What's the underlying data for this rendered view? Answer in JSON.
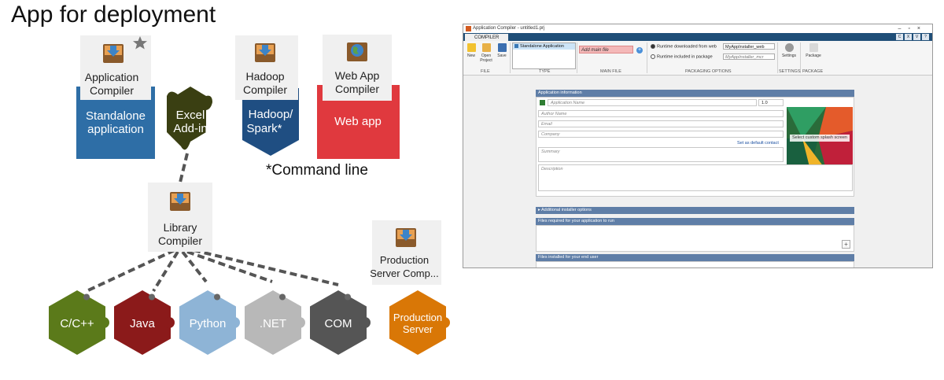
{
  "title": "App for deployment",
  "note": "*Command line",
  "diagram": {
    "compilers": {
      "application": {
        "line1": "Application",
        "line2": "Compiler"
      },
      "hadoop": {
        "line1": "Hadoop",
        "line2": "Compiler"
      },
      "webapp": {
        "line1": "Web App",
        "line2": "Compiler"
      },
      "library": {
        "line1": "Library",
        "line2": "Compiler"
      },
      "production": {
        "line1": "Production",
        "line2": "Server Comp..."
      }
    },
    "targets": {
      "standalone": {
        "line1": "Standalone",
        "line2": "application",
        "color": "#2e6ea6"
      },
      "excel": {
        "line1": "Excel",
        "line2": "Add-in",
        "color": "#3a3f12"
      },
      "hadoop": {
        "line1": "Hadoop/",
        "line2": "Spark*",
        "color": "#1f4e82"
      },
      "webapp": {
        "line1": "Web app",
        "color": "#e0393e"
      }
    },
    "languages": [
      {
        "label": "C/C++",
        "color": "#5b7a1a"
      },
      {
        "label": "Java",
        "color": "#8b1a1a"
      },
      {
        "label": "Python",
        "color": "#8eb4d6"
      },
      {
        "label": ".NET",
        "color": "#b8b8b8"
      },
      {
        "label": "COM",
        "color": "#555555"
      },
      {
        "line1": "Production",
        "line2": "Server",
        "color": "#d97706"
      }
    ]
  },
  "app_window": {
    "title": "Application Compiler - untitled1.prj",
    "tab": "COMPILER",
    "quick_access": [
      "C",
      "X",
      "V"
    ],
    "ribbon": {
      "new": "New",
      "open_line1": "Open",
      "open_line2": "Project",
      "save": "Save",
      "type_selected": "Standalone Application",
      "main_file_placeholder": "Add main file",
      "runtime_web": "Runtime downloaded from web",
      "runtime_web_value": "MyAppInstaller_web",
      "runtime_pkg": "Runtime included in package",
      "runtime_pkg_value": "MyAppInstaller_mcr",
      "settings": "Settings",
      "package": "Package",
      "sections": [
        "FILE",
        "TYPE",
        "MAIN FILE",
        "PACKAGING OPTIONS",
        "SETTINGS",
        "PACKAGE"
      ]
    },
    "app_info": {
      "header": "Application information",
      "name_placeholder": "Application Name",
      "version": "1.0",
      "author_placeholder": "Author Name",
      "email_placeholder": "Email",
      "company_placeholder": "Company",
      "default_contact_link": "Set as default contact",
      "summary_placeholder": "Summary",
      "description_placeholder": "Description",
      "splash_button": "Select custom splash screen"
    },
    "additional_options": "Additional installer options",
    "files_required": "Files required for your application to run",
    "files_installed": "Files installed for your end user"
  }
}
